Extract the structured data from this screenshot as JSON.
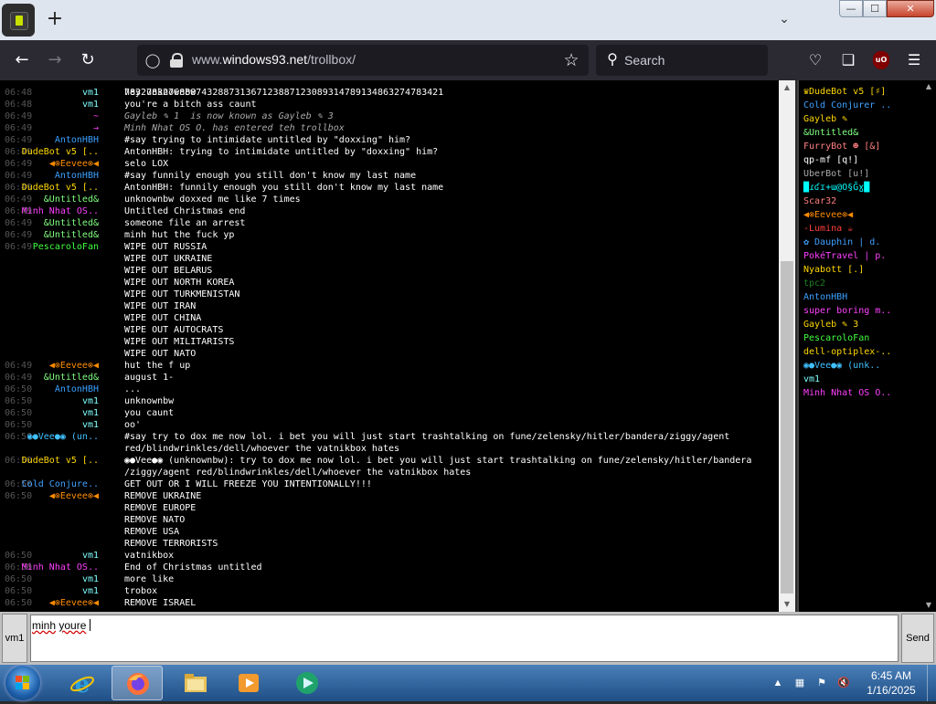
{
  "browser": {
    "url_prefix": "www.",
    "url_domain": "windows93.net",
    "url_path": "/trollbox/",
    "search_placeholder": "Search"
  },
  "window_buttons": {
    "minimize": "—",
    "maximize": "☐",
    "close": "✕"
  },
  "chat": {
    "partial_top_line": "7832783276888743288731367123887123089314789134863274783421",
    "messages": [
      {
        "time": "06:48",
        "name": "vm1",
        "name_color": "#80ffff",
        "text": "hey unknownbw"
      },
      {
        "time": "06:48",
        "name": "vm1",
        "name_color": "#80ffff",
        "text": "you're a bitch ass caunt"
      },
      {
        "time": "06:49",
        "name": "~",
        "name_color": "#ff40ff",
        "text": "Gayleb ✎ 1  is now known as Gayleb ✎ 3",
        "system": true
      },
      {
        "time": "06:49",
        "name": "→",
        "name_color": "#ff40ff",
        "text": "Minh Nhat OS O. has entered teh trollbox",
        "system": true
      },
      {
        "time": "06:49",
        "name": "AntonHBH",
        "name_color": "#3aa0ff",
        "text": "#say trying to intimidate untitled by \"doxxing\" him?"
      },
      {
        "time": "06:49",
        "name": "DudeBot v5 [..",
        "name_color": "#ffd700",
        "text": "AntonHBH: trying to intimidate untitled by \"doxxing\" him?"
      },
      {
        "time": "06:49",
        "name": "◀⊗Eevee⊗◀",
        "name_color": "#ff8c00",
        "text": "selo LOX"
      },
      {
        "time": "06:49",
        "name": "AntonHBH",
        "name_color": "#3aa0ff",
        "text": "#say funnily enough you still don't know my last name"
      },
      {
        "time": "06:49",
        "name": "DudeBot v5 [..",
        "name_color": "#ffd700",
        "text": "AntonHBH: funnily enough you still don't know my last name"
      },
      {
        "time": "06:49",
        "name": "&Untitled&",
        "name_color": "#80ff80",
        "text": "unknownbw doxxed me like 7 times"
      },
      {
        "time": "06:49",
        "name": "Minh Nhat OS..",
        "name_color": "#ff40ff",
        "text": "Untitled Christmas end"
      },
      {
        "time": "06:49",
        "name": "&Untitled&",
        "name_color": "#80ff80",
        "text": "someone file an arrest"
      },
      {
        "time": "06:49",
        "name": "&Untitled&",
        "name_color": "#80ff80",
        "text": "minh hut the fuck yp"
      },
      {
        "time": "06:49",
        "name": "PescaroloFan",
        "name_color": "#40ff40",
        "text": "WIPE OUT RUSSIA"
      },
      {
        "time": "",
        "name": "",
        "name_color": "#ffffff",
        "text": "WIPE OUT UKRAINE"
      },
      {
        "time": "",
        "name": "",
        "name_color": "#ffffff",
        "text": "WIPE OUT BELARUS"
      },
      {
        "time": "",
        "name": "",
        "name_color": "#ffffff",
        "text": "WIPE OUT NORTH KOREA"
      },
      {
        "time": "",
        "name": "",
        "name_color": "#ffffff",
        "text": "WIPE OUT TURKMENISTAN"
      },
      {
        "time": "",
        "name": "",
        "name_color": "#ffffff",
        "text": "WIPE OUT IRAN"
      },
      {
        "time": "",
        "name": "",
        "name_color": "#ffffff",
        "text": "WIPE OUT CHINA"
      },
      {
        "time": "",
        "name": "",
        "name_color": "#ffffff",
        "text": "WIPE OUT AUTOCRATS"
      },
      {
        "time": "",
        "name": "",
        "name_color": "#ffffff",
        "text": "WIPE OUT MILITARISTS"
      },
      {
        "time": "",
        "name": "",
        "name_color": "#ffffff",
        "text": "WIPE OUT NATO"
      },
      {
        "time": "06:49",
        "name": "◀⊗Eevee⊗◀",
        "name_color": "#ff8c00",
        "text": "hut the f up"
      },
      {
        "time": "06:49",
        "name": "&Untitled&",
        "name_color": "#80ff80",
        "text": "august 1-"
      },
      {
        "time": "06:50",
        "name": "AntonHBH",
        "name_color": "#3aa0ff",
        "text": "..."
      },
      {
        "time": "06:50",
        "name": "vm1",
        "name_color": "#80ffff",
        "text": "unknownbw"
      },
      {
        "time": "06:50",
        "name": "vm1",
        "name_color": "#80ffff",
        "text": "you caunt"
      },
      {
        "time": "06:50",
        "name": "vm1",
        "name_color": "#80ffff",
        "text": "oo'"
      },
      {
        "time": "06:50",
        "name": "◉●Vee●◉ (un..",
        "name_color": "#40c0ff",
        "text": "#say try to dox me now lol. i bet you will just start trashtalking on fune/zelensky/hitler/bandera/ziggy/agent"
      },
      {
        "time": "",
        "name": "",
        "name_color": "#ffffff",
        "text": "red/blindwrinkles/dell/whoever the vatnikbox hates"
      },
      {
        "time": "06:50",
        "name": "DudeBot v5 [..",
        "name_color": "#ffd700",
        "text": "◉●Vee●◉ (unknownbw): try to dox me now lol. i bet you will just start trashtalking on fune/zelensky/hitler/bandera"
      },
      {
        "time": "",
        "name": "",
        "name_color": "#ffffff",
        "text": "/ziggy/agent red/blindwrinkles/dell/whoever the vatnikbox hates"
      },
      {
        "time": "06:50",
        "name": "Cold Conjure..",
        "name_color": "#40a0ff",
        "text": "GET OUT OR I WILL FREEZE YOU INTENTIONALLY!!!"
      },
      {
        "time": "06:50",
        "name": "◀⊗Eevee⊗◀",
        "name_color": "#ff8c00",
        "text": "REMOVE UKRAINE"
      },
      {
        "time": "",
        "name": "",
        "name_color": "#ffffff",
        "text": "REMOVE EUROPE"
      },
      {
        "time": "",
        "name": "",
        "name_color": "#ffffff",
        "text": "REMOVE NATO"
      },
      {
        "time": "",
        "name": "",
        "name_color": "#ffffff",
        "text": "REMOVE USA"
      },
      {
        "time": "",
        "name": "",
        "name_color": "#ffffff",
        "text": "REMOVE TERRORISTS"
      },
      {
        "time": "06:50",
        "name": "vm1",
        "name_color": "#80ffff",
        "text": "vatnikbox"
      },
      {
        "time": "06:50",
        "name": "Minh Nhat OS..",
        "name_color": "#ff40ff",
        "text": "End of Christmas untitled"
      },
      {
        "time": "06:50",
        "name": "vm1",
        "name_color": "#80ffff",
        "text": "more like"
      },
      {
        "time": "06:50",
        "name": "vm1",
        "name_color": "#80ffff",
        "text": "trobox"
      },
      {
        "time": "06:50",
        "name": "◀⊗Eevee⊗◀",
        "name_color": "#ff8c00",
        "text": "REMOVE ISRAEL"
      }
    ]
  },
  "users": [
    {
      "name": "♛DudeBot v5 [♯]",
      "color": "#ffd700"
    },
    {
      "name": "Cold Conjurer ..",
      "color": "#40a0ff"
    },
    {
      "name": "Gayleb ✎",
      "color": "#ffd700"
    },
    {
      "name": "&Untitled&",
      "color": "#80ff80"
    },
    {
      "name": "FurryBot ☻ [&]",
      "color": "#ff8080"
    },
    {
      "name": "qp-mf [q!]",
      "color": "#ffffff"
    },
    {
      "name": "UberBot [u!]",
      "color": "#aaaaaa"
    },
    {
      "name": "█ɾʛɪ+ɯ@O§Ğɣ█",
      "color": "#00ffff"
    },
    {
      "name": "Scar32",
      "color": "#ff8080"
    },
    {
      "name": "◀⊗Eevee⊗◀",
      "color": "#ff8c00"
    },
    {
      "name": "-Lumina ☕",
      "color": "#ff4040"
    },
    {
      "name": "✿ Dauphin | d.",
      "color": "#40a0ff"
    },
    {
      "name": "PokéTravel | p.",
      "color": "#ff40ff"
    },
    {
      "name": "Nyabott [.]",
      "color": "#ffd700"
    },
    {
      "name": "tpc2",
      "color": "#208020"
    },
    {
      "name": "AntonHBH",
      "color": "#3aa0ff"
    },
    {
      "name": "super boring m..",
      "color": "#ff40ff"
    },
    {
      "name": "Gayleb ✎ 3",
      "color": "#ffd700"
    },
    {
      "name": "PescaroloFan",
      "color": "#40ff40"
    },
    {
      "name": "dell-optiplex-..",
      "color": "#ffd700"
    },
    {
      "name": "◉●Vee●◉ (unk..",
      "color": "#40c0ff"
    },
    {
      "name": "vm1",
      "color": "#80ffff"
    },
    {
      "name": "Minh Nhat OS O..",
      "color": "#ff40ff"
    }
  ],
  "input": {
    "nick": "vm1",
    "typed_word1": "minh",
    "typed_word2": "youre",
    "send_label": "Send"
  },
  "taskbar": {
    "time": "6:45 AM",
    "date": "1/16/2025"
  }
}
